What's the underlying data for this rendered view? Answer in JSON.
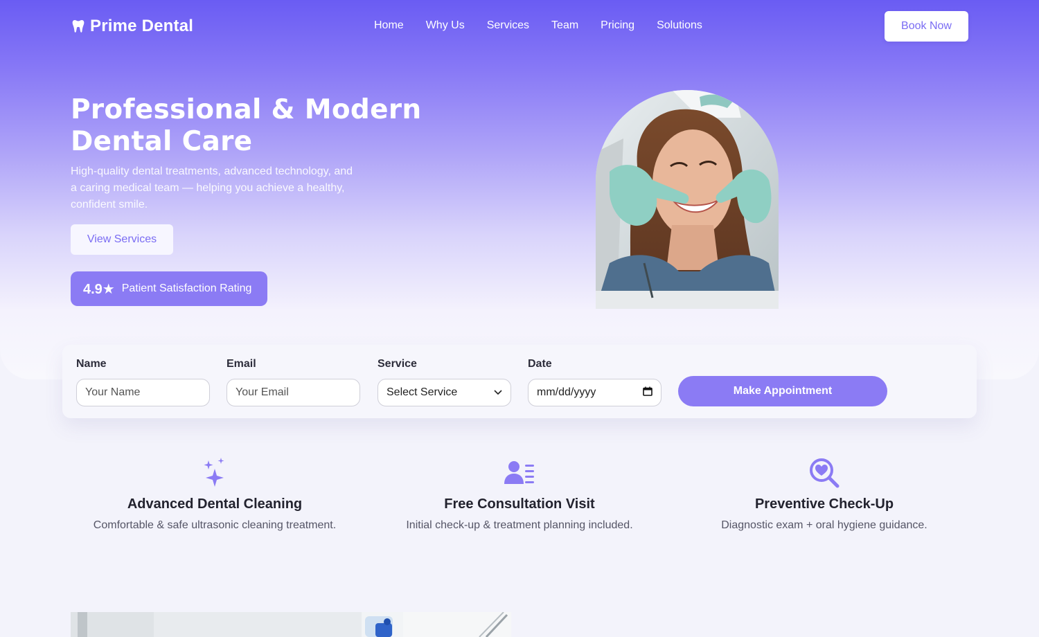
{
  "brand": {
    "name": "Prime Dental",
    "icon": "tooth-icon"
  },
  "nav": {
    "items": [
      {
        "label": "Home"
      },
      {
        "label": "Why Us"
      },
      {
        "label": "Services"
      },
      {
        "label": "Team"
      },
      {
        "label": "Pricing"
      },
      {
        "label": "Solutions"
      }
    ],
    "cta_label": "Book Now"
  },
  "hero": {
    "title": "Professional & Modern Dental Care",
    "subtitle": "High-quality dental treatments, advanced technology, and a caring medical team — helping you achieve a healthy, confident smile.",
    "primary_button": "View Services",
    "rating": {
      "score": "4.9★",
      "label": "Patient Satisfaction Rating"
    }
  },
  "appointment_form": {
    "name": {
      "label": "Name",
      "placeholder": "Your Name"
    },
    "email": {
      "label": "Email",
      "placeholder": "Your Email"
    },
    "service": {
      "label": "Service",
      "selected": "Select Service"
    },
    "date": {
      "label": "Date",
      "value": "mm/dd/yyyy"
    },
    "submit_label": "Make Appointment"
  },
  "features": [
    {
      "icon": "sparkles-icon",
      "title": "Advanced Dental Cleaning",
      "description": "Comfortable & safe ultrasonic cleaning treatment."
    },
    {
      "icon": "user-list-icon",
      "title": "Free Consultation Visit",
      "description": "Initial check-up & treatment planning included."
    },
    {
      "icon": "heart-search-icon",
      "title": "Preventive Check-Up",
      "description": "Diagnostic exam + oral hygiene guidance."
    }
  ],
  "colors": {
    "accent": "#8b7bf4",
    "accent_dark": "#6a5cf3",
    "page_bg": "#f3f3fb"
  }
}
